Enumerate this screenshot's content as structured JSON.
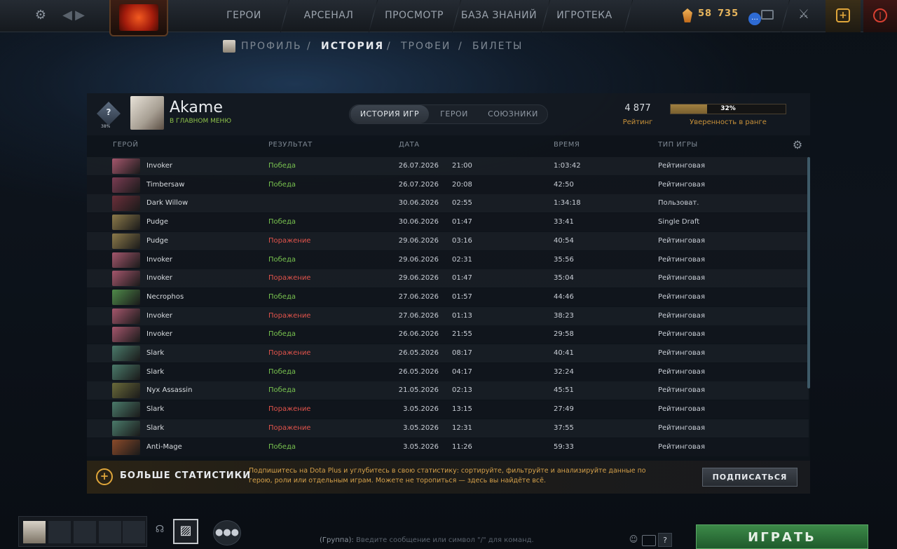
{
  "nav": {
    "items": [
      "ГЕРОИ",
      "АРСЕНАЛ",
      "ПРОСМОТР",
      "БАЗА ЗНАНИЙ",
      "ИГРОТЕКА"
    ],
    "currency_1": "58",
    "currency_2": "735"
  },
  "subnav": {
    "items": [
      "ПРОФИЛЬ",
      "ИСТОРИЯ",
      "ТРОФЕИ",
      "БИЛЕТЫ"
    ],
    "separator": "/",
    "active": "ИСТОРИЯ"
  },
  "profile": {
    "rank_badge_text": "?",
    "rank_percent": "38%",
    "name": "Akame",
    "status": "В ГЛАВНОМ МЕНЮ",
    "rating_value": "4 877",
    "rating_label": "Рейтинг",
    "confidence_value": "32%",
    "confidence_label": "Уверенность в ранге",
    "confidence_fill": 0.32
  },
  "tabs": [
    "ИСТОРИЯ ИГР",
    "ГЕРОИ",
    "СОЮЗНИКИ"
  ],
  "columns": {
    "hero": "ГЕРОЙ",
    "result": "РЕЗУЛЬТАТ",
    "date": "ДАТА",
    "time": "ВРЕМЯ",
    "type": "ТИП ИГРЫ"
  },
  "matches": [
    {
      "hero": "Invoker",
      "result": "Победа",
      "outcome": "win",
      "date": "26.07.2026",
      "clock": "21:00",
      "duration": "1:03:42",
      "type": "Рейтинговая",
      "color": "#a4566c"
    },
    {
      "hero": "Timbersaw",
      "result": "Победа",
      "outcome": "win",
      "date": "26.07.2026",
      "clock": "20:08",
      "duration": "42:50",
      "type": "Рейтинговая",
      "color": "#7a3c52"
    },
    {
      "hero": "Dark Willow",
      "result": "",
      "outcome": "none",
      "date": "30.06.2026",
      "clock": "02:55",
      "duration": "1:34:18",
      "type": "Пользоват.",
      "color": "#6b2f3a"
    },
    {
      "hero": "Pudge",
      "result": "Победа",
      "outcome": "win",
      "date": "30.06.2026",
      "clock": "01:47",
      "duration": "33:41",
      "type": "Single Draft",
      "color": "#8c7a4a"
    },
    {
      "hero": "Pudge",
      "result": "Поражение",
      "outcome": "loss",
      "date": "29.06.2026",
      "clock": "03:16",
      "duration": "40:54",
      "type": "Рейтинговая",
      "color": "#8c7a4a"
    },
    {
      "hero": "Invoker",
      "result": "Победа",
      "outcome": "win",
      "date": "29.06.2026",
      "clock": "02:31",
      "duration": "35:56",
      "type": "Рейтинговая",
      "color": "#a4566c"
    },
    {
      "hero": "Invoker",
      "result": "Поражение",
      "outcome": "loss",
      "date": "29.06.2026",
      "clock": "01:47",
      "duration": "35:04",
      "type": "Рейтинговая",
      "color": "#a4566c"
    },
    {
      "hero": "Necrophos",
      "result": "Победа",
      "outcome": "win",
      "date": "27.06.2026",
      "clock": "01:57",
      "duration": "44:46",
      "type": "Рейтинговая",
      "color": "#4f8a4a"
    },
    {
      "hero": "Invoker",
      "result": "Поражение",
      "outcome": "loss",
      "date": "27.06.2026",
      "clock": "01:13",
      "duration": "38:23",
      "type": "Рейтинговая",
      "color": "#a4566c"
    },
    {
      "hero": "Invoker",
      "result": "Победа",
      "outcome": "win",
      "date": "26.06.2026",
      "clock": "21:55",
      "duration": "29:58",
      "type": "Рейтинговая",
      "color": "#a4566c"
    },
    {
      "hero": "Slark",
      "result": "Поражение",
      "outcome": "loss",
      "date": "26.05.2026",
      "clock": "08:17",
      "duration": "40:41",
      "type": "Рейтинговая",
      "color": "#4a7a6a"
    },
    {
      "hero": "Slark",
      "result": "Победа",
      "outcome": "win",
      "date": "26.05.2026",
      "clock": "04:17",
      "duration": "32:24",
      "type": "Рейтинговая",
      "color": "#4a7a6a"
    },
    {
      "hero": "Nyx Assassin",
      "result": "Победа",
      "outcome": "win",
      "date": "21.05.2026",
      "clock": "02:13",
      "duration": "45:51",
      "type": "Рейтинговая",
      "color": "#6a6a3a"
    },
    {
      "hero": "Slark",
      "result": "Поражение",
      "outcome": "loss",
      "date": "3.05.2026",
      "clock": "13:15",
      "duration": "27:49",
      "type": "Рейтинговая",
      "color": "#4a7a6a"
    },
    {
      "hero": "Slark",
      "result": "Поражение",
      "outcome": "loss",
      "date": "3.05.2026",
      "clock": "12:31",
      "duration": "37:55",
      "type": "Рейтинговая",
      "color": "#4a7a6a"
    },
    {
      "hero": "Anti-Mage",
      "result": "Победа",
      "outcome": "win",
      "date": "3.05.2026",
      "clock": "11:26",
      "duration": "59:33",
      "type": "Рейтинговая",
      "color": "#8a4a2a"
    }
  ],
  "plus": {
    "title": "БОЛЬШЕ СТАТИСТИКИ",
    "text": "Подпишитесь на Dota Plus и углубитесь в свою статистику: сортируйте, фильтруйте и анализируйте данные по герою, роли или отдельным играм. Можете не торопиться — здесь вы найдёте всё.",
    "button": "ПОДПИСАТЬСЯ"
  },
  "chat": {
    "channel": "(Группа):",
    "placeholder": "Введите сообщение или символ \"/\" для команд."
  },
  "play_button": "ИГРАТЬ",
  "help": "?"
}
